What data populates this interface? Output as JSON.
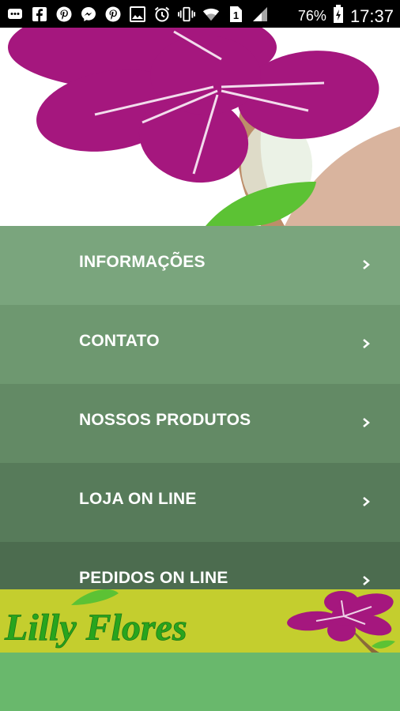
{
  "status_bar": {
    "battery": "76%",
    "time": "17:37",
    "sim_slot": "1",
    "icons": [
      "messages-icon",
      "facebook-icon",
      "pinterest-icon",
      "messenger-icon",
      "pinterest-icon",
      "gallery-icon",
      "alarm-icon",
      "vibrate-icon",
      "wifi-icon",
      "sim-1-icon",
      "signal-icon",
      "battery-icon"
    ]
  },
  "menu": {
    "items": [
      {
        "label": "INFORMAÇÕES",
        "color": "#7aa57d"
      },
      {
        "label": "CONTATO",
        "color": "#6e9870"
      },
      {
        "label": "NOSSOS PRODUTOS",
        "color": "#638a65"
      },
      {
        "label": "LOJA ON LINE",
        "color": "#577b5a"
      },
      {
        "label": "PEDIDOS ON LINE",
        "color": "#4c6c4f"
      }
    ]
  },
  "banner": {
    "brand": "Lilly Flores",
    "text_color": "#28a51e",
    "background": "#c4ce2e"
  },
  "colors": {
    "petal": "#a5177e",
    "leaf": "#5cc234",
    "bottom": "#69b86c"
  }
}
